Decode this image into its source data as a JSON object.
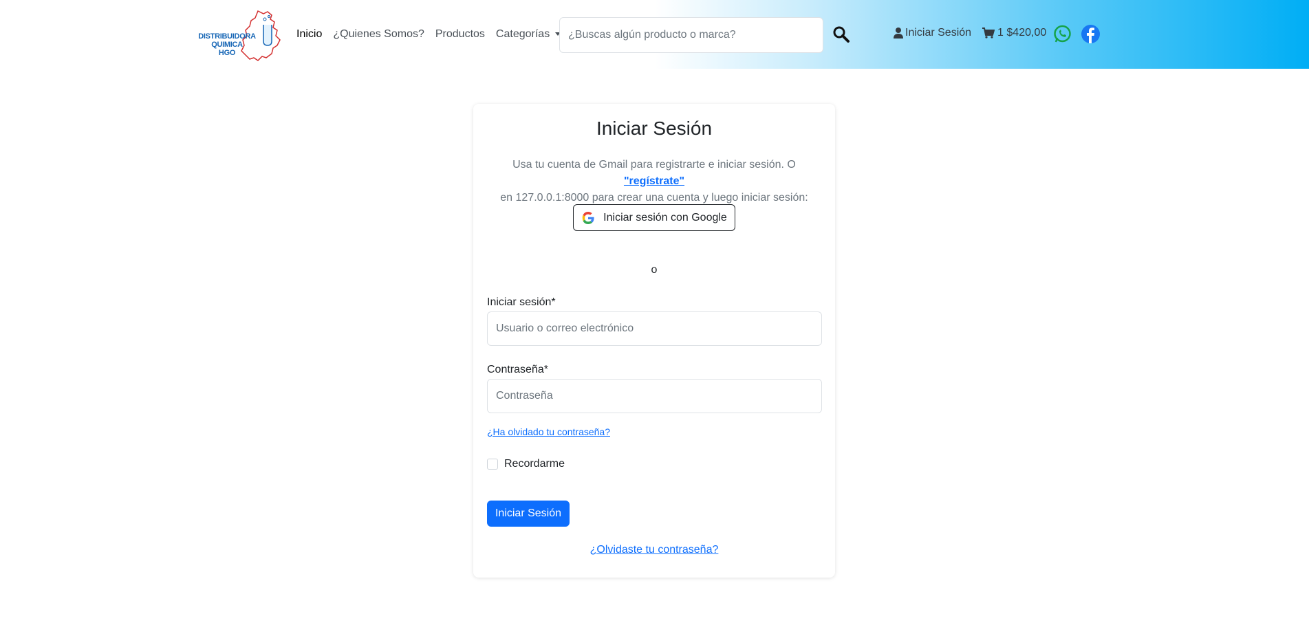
{
  "header": {
    "logo_text": [
      "DISTRIBUIDORA",
      "QUIMICA",
      "HGO"
    ],
    "nav": [
      {
        "label": "Inicio"
      },
      {
        "label": "¿Quienes Somos?"
      },
      {
        "label": "Productos"
      },
      {
        "label": "Categorías"
      }
    ],
    "search_placeholder": "¿Buscas algún producto o marca?",
    "login_label": "Iniciar Sesión",
    "cart_count": "1",
    "cart_total": "$420,00",
    "colors": {
      "whatsapp": "#16a34a",
      "facebook": "#1877f2",
      "gradient_end": "#00aef5"
    }
  },
  "card": {
    "title": "Iniciar Sesión",
    "desc_part1": "Usa tu cuenta de Gmail para registrarte e iniciar sesión. O ",
    "desc_link": "\"regístrate\"",
    "desc_part2": "en 127.0.0.1:8000 para crear una cuenta y luego iniciar sesión:",
    "google_button": "Iniciar sesión con Google",
    "or_text": "o",
    "login_label": "Iniciar sesión*",
    "login_placeholder": "Usuario o correo electrónico",
    "password_label": "Contraseña*",
    "password_placeholder": "Contraseña",
    "forgot_small": "¿Ha olvidado tu contraseña?",
    "remember": "Recordarme",
    "submit": "Iniciar Sesión",
    "forgot_big": "¿Olvidaste tu contraseña?",
    "primary_color": "#0d6efd"
  }
}
